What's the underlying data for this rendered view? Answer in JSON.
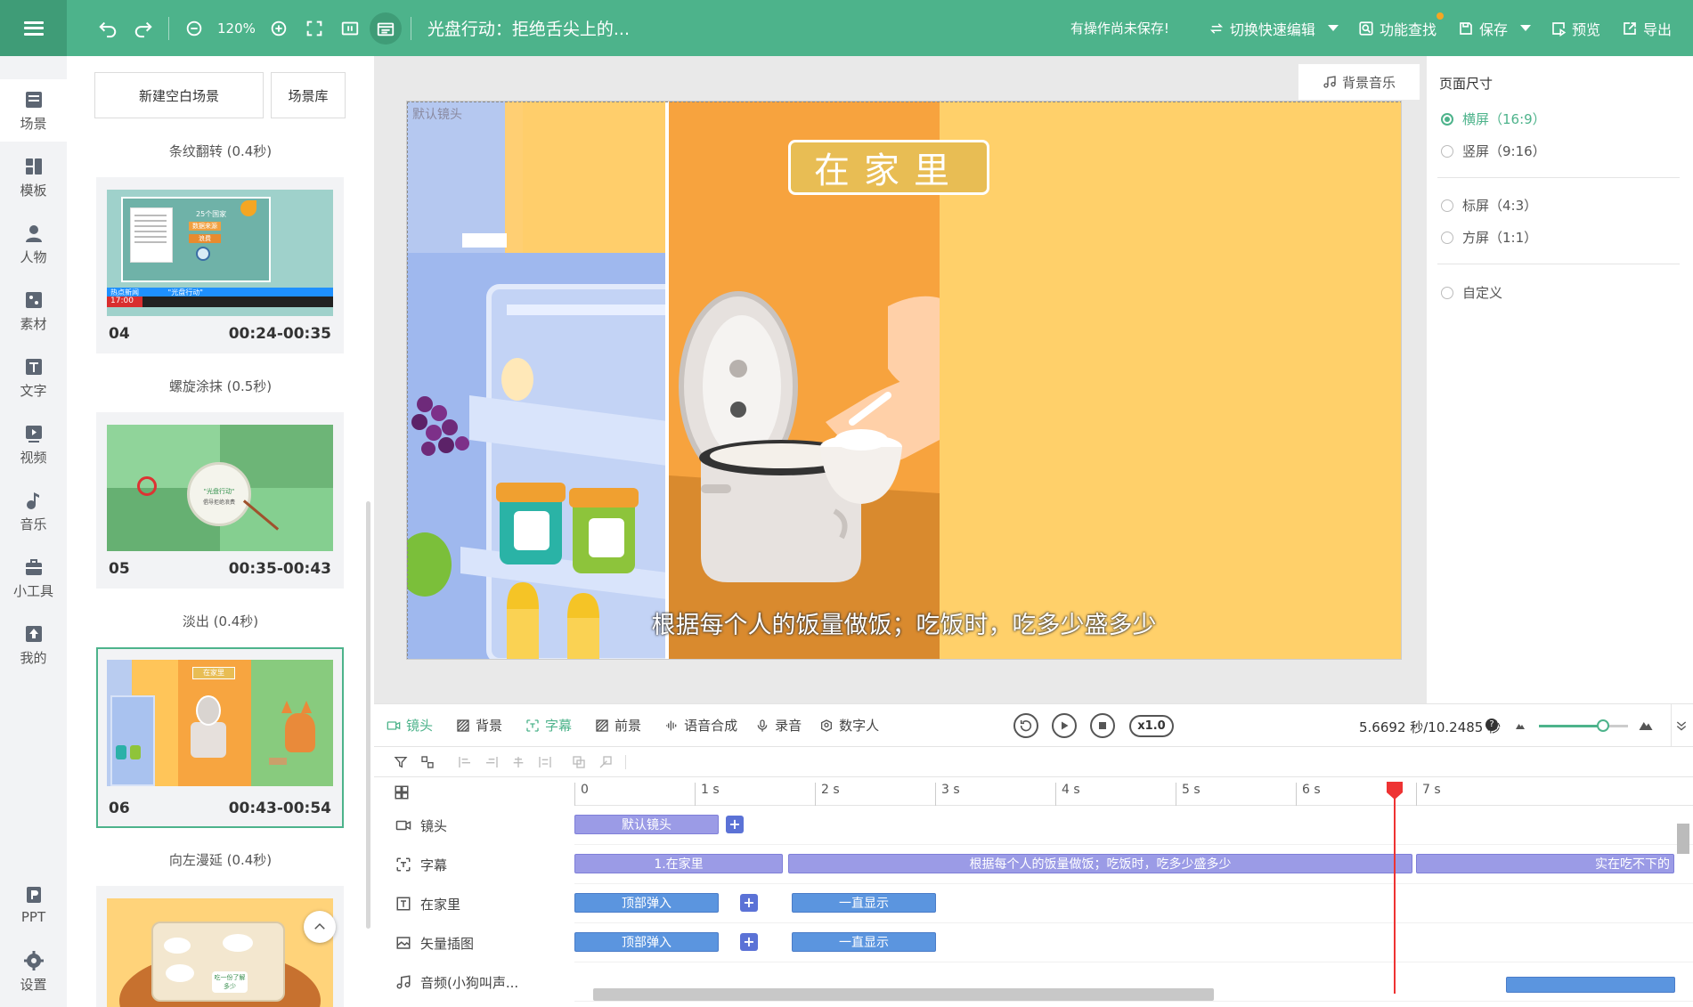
{
  "topbar": {
    "zoom": "120%",
    "title": "光盘行动：拒绝舌尖上的...",
    "unsaved": "有操作尚未保存!",
    "switch_edit": "切换快速编辑",
    "find": "功能查找",
    "save": "保存",
    "preview": "预览",
    "export": "导出"
  },
  "sidenav": {
    "items": [
      {
        "label": "场景",
        "icon": "scene-icon"
      },
      {
        "label": "模板",
        "icon": "template-icon"
      },
      {
        "label": "人物",
        "icon": "person-icon"
      },
      {
        "label": "素材",
        "icon": "material-icon"
      },
      {
        "label": "文字",
        "icon": "text-icon"
      },
      {
        "label": "视频",
        "icon": "video-icon"
      },
      {
        "label": "音乐",
        "icon": "music-icon"
      },
      {
        "label": "小工具",
        "icon": "toolbox-icon"
      },
      {
        "label": "我的",
        "icon": "upload-icon"
      },
      {
        "label": "PPT",
        "icon": "ppt-icon"
      },
      {
        "label": "设置",
        "icon": "gear-icon"
      }
    ]
  },
  "scenes": {
    "new_blank": "新建空白场景",
    "library": "场景库",
    "transitions": [
      "条纹翻转 (0.4秒)",
      "螺旋涂抹 (0.5秒)",
      "淡出 (0.4秒)",
      "向左漫延 (0.4秒)"
    ],
    "cards": [
      {
        "num": "04",
        "time": "00:24-00:35",
        "caption_a": "热点新闻",
        "caption_b": "\"光盘行动\"",
        "clock": "17:00",
        "badge_a": "25个国家",
        "badge_b": "数据来源",
        "badge_c": "浪费"
      },
      {
        "num": "05",
        "time": "00:35-00:43",
        "badge_a": "\"光盘行动\"",
        "badge_b": "倡导拒绝浪费"
      },
      {
        "num": "06",
        "time": "00:43-00:54",
        "sign": "在家里"
      },
      {
        "num": "",
        "time": "",
        "badge": "吃一份了解多少"
      }
    ]
  },
  "canvas": {
    "bgm": "背景音乐",
    "camera_label": "默认镜头",
    "sign": "在家里",
    "subtitle": "根据每个人的饭量做饭；吃饭时，吃多少盛多少"
  },
  "page_size": {
    "title": "页面尺寸",
    "options": [
      {
        "label": "横屏（16:9）",
        "selected": true
      },
      {
        "label": "竖屏（9:16）",
        "selected": false
      },
      {
        "label": "标屏（4:3）",
        "selected": false
      },
      {
        "label": "方屏（1:1）",
        "selected": false
      },
      {
        "label": "自定义",
        "selected": false
      }
    ]
  },
  "timeline": {
    "tabs": [
      "镜头",
      "背景",
      "字幕",
      "前景",
      "语音合成",
      "录音",
      "数字人"
    ],
    "speed": "x1.0",
    "time": "5.6692 秒/10.2485 秒",
    "zoom_level": 0.72,
    "ruler": [
      "0",
      "1 s",
      "2 s",
      "3 s",
      "4 s",
      "5 s",
      "6 s",
      "7 s"
    ],
    "playhead_seconds": 5.6692,
    "tracks": [
      {
        "name": "镜头",
        "icon": "camera-icon",
        "clips": [
          {
            "label": "默认镜头"
          }
        ]
      },
      {
        "name": "字幕",
        "icon": "subtitle-icon",
        "clips": [
          {
            "label": "1.在家里"
          },
          {
            "label": "根据每个人的饭量做饭；吃饭时，吃多少盛多少"
          },
          {
            "label": "实在吃不下的"
          }
        ]
      },
      {
        "name": "在家里",
        "icon": "textbox-icon",
        "clips": [
          {
            "label": "顶部弹入"
          },
          {
            "label": "一直显示"
          }
        ]
      },
      {
        "name": "矢量插图",
        "icon": "image-icon",
        "clips": [
          {
            "label": "顶部弹入"
          },
          {
            "label": "一直显示"
          }
        ]
      },
      {
        "name": "音频(小狗叫声...",
        "icon": "audio-icon",
        "clips": [
          {
            "label": ""
          }
        ]
      }
    ]
  },
  "colors": {
    "accent": "#4db38b",
    "clip_purple": "#9b9be6",
    "clip_blue": "#5b95df",
    "playhead": "#e33333"
  }
}
